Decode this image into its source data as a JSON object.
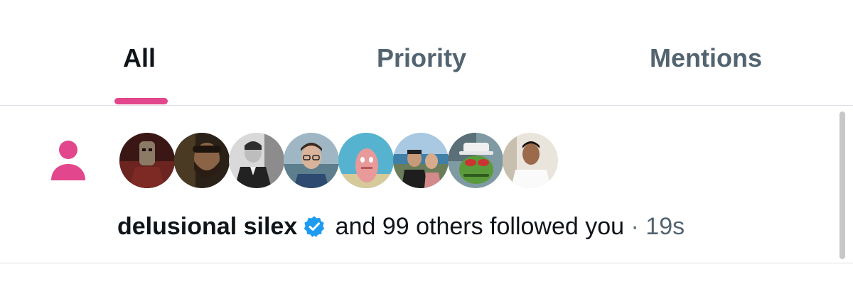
{
  "tabs": [
    {
      "label": "All",
      "active": true
    },
    {
      "label": "Priority",
      "active": false
    },
    {
      "label": "Mentions",
      "active": false
    }
  ],
  "colors": {
    "accent": "#e2468c",
    "verified": "#1d9bf0",
    "text_primary": "#0f1419",
    "text_secondary": "#536471"
  },
  "notification": {
    "type_icon": "person-icon",
    "avatars": [
      {
        "name": "avatar-1"
      },
      {
        "name": "avatar-2"
      },
      {
        "name": "avatar-3"
      },
      {
        "name": "avatar-4"
      },
      {
        "name": "avatar-5"
      },
      {
        "name": "avatar-6"
      },
      {
        "name": "avatar-7"
      },
      {
        "name": "avatar-8"
      }
    ],
    "user_name": "delusional silex",
    "verified_icon": "verified-badge-icon",
    "action_text": " and 99 others followed you",
    "separator": " · ",
    "time": "19s"
  }
}
